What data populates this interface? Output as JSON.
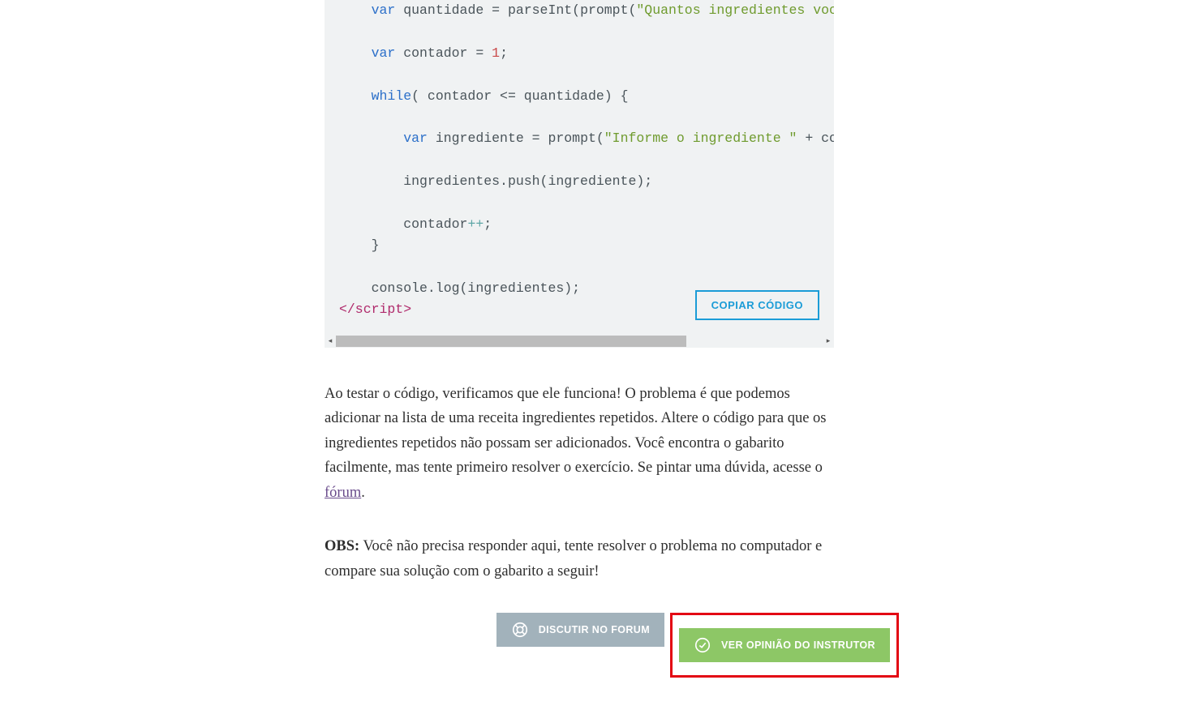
{
  "code": {
    "line1_kw": "var",
    "line1_rest": " quantidade = parseInt(prompt(",
    "line1_str": "\"Quantos ingredientes você",
    "line2_kw": "var",
    "line2_a": " contador = ",
    "line2_num": "1",
    "line2_end": ";",
    "line3_kw": "while",
    "line3_rest": "( contador <= quantidade) {",
    "line4_kw": "var",
    "line4_a": " ingrediente = prompt(",
    "line4_str": "\"Informe o ingrediente \"",
    "line4_b": " + con",
    "line5": "ingredientes.push(ingrediente);",
    "line6_a": "contador",
    "line6_op": "++",
    "line6_b": ";",
    "line7": "}",
    "line8": "console.log(ingredientes);",
    "line9_tag": "</script​>"
  },
  "buttons": {
    "copy": "COPIAR CÓDIGO",
    "forum": "DISCUTIR NO FORUM",
    "instructor": "VER OPINIÃO DO INSTRUTOR"
  },
  "text": {
    "para1_a": "Ao testar o código, verificamos que ele funciona! O problema é que podemos adicionar na lista de uma receita ingredientes repetidos. Altere o código para que os ingredientes repetidos não possam ser adicionados. Você encontra o gabarito facilmente, mas tente primeiro resolver o exercício. Se pintar uma dúvida, acesse o ",
    "para1_link": "fórum",
    "para1_b": ".",
    "para2_strong": "OBS:",
    "para2_rest": " Você não precisa responder aqui, tente resolver o problema no computador e compare sua solução com o gabarito a seguir!"
  }
}
